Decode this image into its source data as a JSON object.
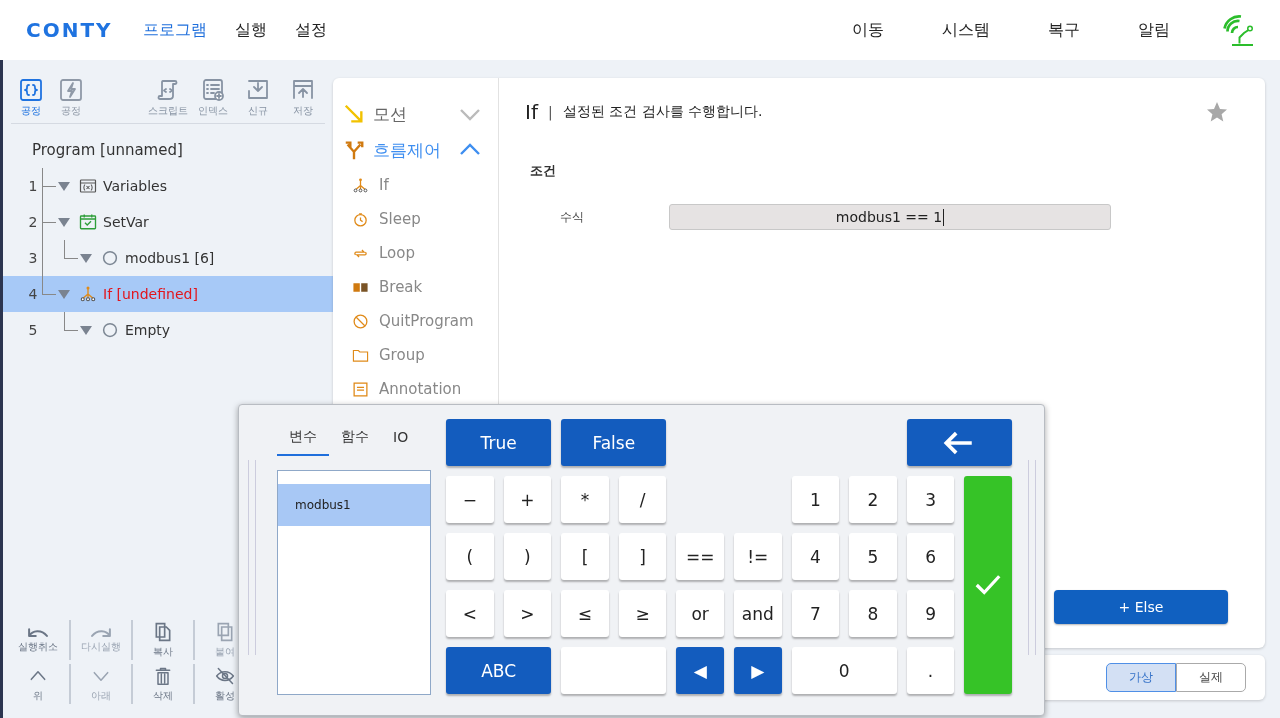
{
  "header": {
    "logo": "CONTY",
    "menu": [
      {
        "label": "프로그램",
        "selected": true
      },
      {
        "label": "실행",
        "selected": false
      },
      {
        "label": "설정",
        "selected": false
      }
    ],
    "actions": [
      "이동",
      "시스템",
      "복구",
      "알림"
    ]
  },
  "sidebar": {
    "modes": [
      {
        "label": "공정",
        "kind": "code",
        "selected": true
      },
      {
        "label": "공정",
        "kind": "event",
        "selected": false
      }
    ],
    "tools": [
      {
        "label": "스크립트",
        "kind": "script"
      },
      {
        "label": "인덱스",
        "kind": "index"
      },
      {
        "label": "신규",
        "kind": "new"
      },
      {
        "label": "저장",
        "kind": "save"
      }
    ],
    "program_title": "Program [unnamed]",
    "tree": [
      {
        "number": "1",
        "label": "Variables",
        "kind": "variables",
        "expanded": true,
        "selected": false,
        "invalid": false
      },
      {
        "number": "2",
        "label": "SetVar",
        "kind": "setvar",
        "expanded": true,
        "selected": false,
        "invalid": false,
        "children": [
          {
            "number": "3",
            "label": "modbus1 [6]",
            "kind": "value",
            "expanded": true,
            "selected": false,
            "invalid": false
          }
        ]
      },
      {
        "number": "4",
        "label": "If [undefined]",
        "kind": "if",
        "expanded": true,
        "selected": true,
        "invalid": true,
        "children": [
          {
            "number": "5",
            "label": "Empty",
            "kind": "value",
            "expanded": true,
            "selected": false,
            "invalid": false
          }
        ]
      }
    ],
    "edit_tools": [
      {
        "label": "실행취소",
        "kind": "undo",
        "disabled": false
      },
      {
        "label": "다시실행",
        "kind": "redo",
        "disabled": true
      },
      {
        "label": "복사",
        "kind": "copy",
        "disabled": false
      },
      {
        "label": "붙여",
        "kind": "paste",
        "disabled": true
      },
      {
        "label": "위",
        "kind": "up",
        "disabled": false
      },
      {
        "label": "아래",
        "kind": "down",
        "disabled": true
      },
      {
        "label": "삭제",
        "kind": "delete",
        "disabled": false
      },
      {
        "label": "활성",
        "kind": "hide",
        "disabled": false
      }
    ]
  },
  "palette": [
    {
      "label": "모션",
      "kind": "motion",
      "expanded": false
    },
    {
      "label": "흐름제어",
      "kind": "flow",
      "expanded": true,
      "items": [
        {
          "label": "If",
          "kind": "if"
        },
        {
          "label": "Sleep",
          "kind": "sleep"
        },
        {
          "label": "Loop",
          "kind": "loop"
        },
        {
          "label": "Break",
          "kind": "break"
        },
        {
          "label": "QuitProgram",
          "kind": "quit"
        },
        {
          "label": "Group",
          "kind": "group"
        },
        {
          "label": "Annotation",
          "kind": "annotation"
        }
      ]
    }
  ],
  "detail": {
    "title": "If",
    "separator": "|",
    "description": "설정된 조건 검사를 수행합니다.",
    "favorite": false,
    "section": "조건",
    "field_label": "수식",
    "field_value": "modbus1 == 1",
    "else_button": "+ Else"
  },
  "mode_toggle": [
    {
      "label": "가상",
      "selected": true
    },
    {
      "label": "실제",
      "selected": false
    }
  ],
  "keypad": {
    "tabs": [
      {
        "label": "변수",
        "selected": true
      },
      {
        "label": "함수",
        "selected": false
      },
      {
        "label": "IO",
        "selected": false
      }
    ],
    "variables": [
      {
        "label": "modbus1",
        "selected": true
      }
    ],
    "keys": [
      {
        "label": "True",
        "kind": "blue"
      },
      {
        "label": "False",
        "kind": "blue"
      },
      {
        "kind": "backspace"
      },
      {
        "label": "−",
        "kind": "key"
      },
      {
        "label": "+",
        "kind": "key"
      },
      {
        "label": "*",
        "kind": "key"
      },
      {
        "label": "/",
        "kind": "key"
      },
      {
        "label": "1",
        "kind": "key"
      },
      {
        "label": "2",
        "kind": "key"
      },
      {
        "label": "3",
        "kind": "key"
      },
      {
        "kind": "enter"
      },
      {
        "label": "(",
        "kind": "key"
      },
      {
        "label": ")",
        "kind": "key"
      },
      {
        "label": "[",
        "kind": "key"
      },
      {
        "label": "]",
        "kind": "key"
      },
      {
        "label": "==",
        "kind": "key"
      },
      {
        "label": "!=",
        "kind": "key"
      },
      {
        "label": "4",
        "kind": "key"
      },
      {
        "label": "5",
        "kind": "key"
      },
      {
        "label": "6",
        "kind": "key"
      },
      {
        "label": "<",
        "kind": "key"
      },
      {
        "label": ">",
        "kind": "key"
      },
      {
        "label": "≤",
        "kind": "key"
      },
      {
        "label": "≥",
        "kind": "key"
      },
      {
        "label": "or",
        "kind": "key"
      },
      {
        "label": "and",
        "kind": "key"
      },
      {
        "label": "7",
        "kind": "key"
      },
      {
        "label": "8",
        "kind": "key"
      },
      {
        "label": "9",
        "kind": "key"
      },
      {
        "label": "ABC",
        "kind": "blue"
      },
      {
        "kind": "space"
      },
      {
        "label": "◀",
        "kind": "blue"
      },
      {
        "label": "▶",
        "kind": "blue"
      },
      {
        "label": "0",
        "kind": "key"
      },
      {
        "label": ".",
        "kind": "key"
      }
    ]
  }
}
